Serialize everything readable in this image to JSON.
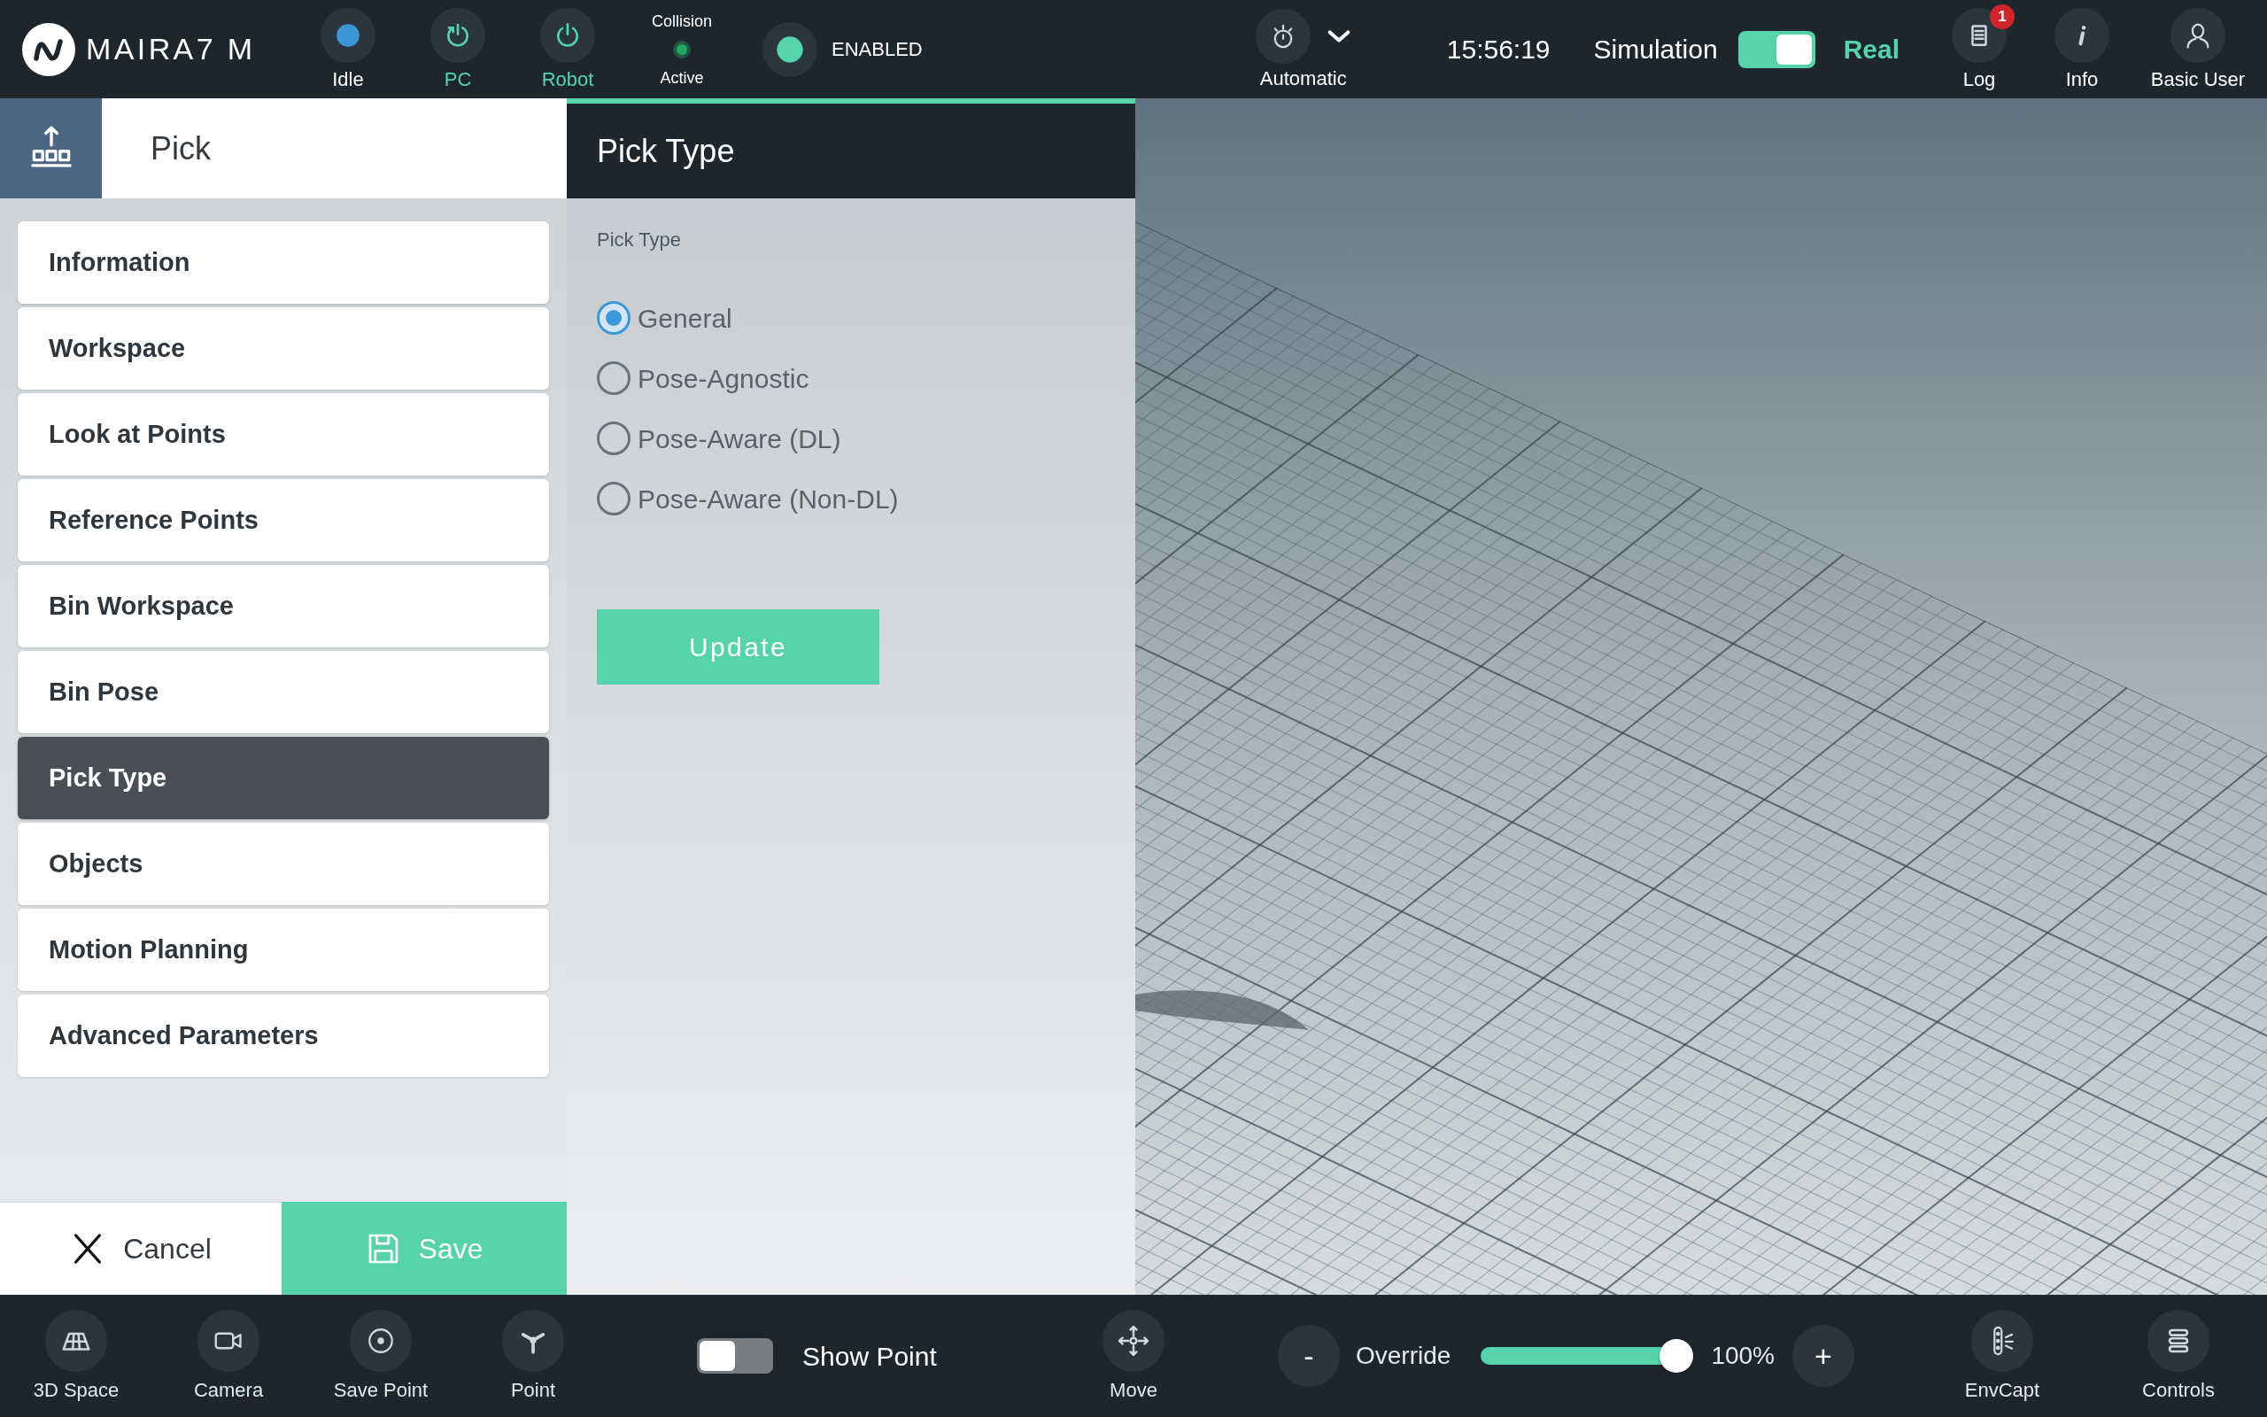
{
  "header": {
    "brand": "MAIRA7 M",
    "status": [
      {
        "kind": "state",
        "label": "Idle"
      },
      {
        "kind": "powercycle",
        "label": "PC",
        "active": true
      },
      {
        "kind": "power",
        "label": "Robot",
        "active": true
      }
    ],
    "collision": {
      "title": "Collision",
      "status": "Active",
      "active": true
    },
    "enable": {
      "label": "ENABLED",
      "on": true
    },
    "mode": {
      "label": "Automatic"
    },
    "time": "15:56:19",
    "mode_switch": {
      "left_label": "Simulation",
      "right_label": "Real",
      "on": true
    },
    "actions": [
      {
        "kind": "log",
        "label": "Log",
        "badge": "1"
      },
      {
        "kind": "info",
        "label": "Info"
      },
      {
        "kind": "user",
        "label": "Basic User"
      }
    ]
  },
  "sidebar": {
    "title": "Pick",
    "items": [
      {
        "label": "Information",
        "selected": false
      },
      {
        "label": "Workspace",
        "selected": false
      },
      {
        "label": "Look at Points",
        "selected": false
      },
      {
        "label": "Reference Points",
        "selected": false
      },
      {
        "label": "Bin Workspace",
        "selected": false
      },
      {
        "label": "Bin Pose",
        "selected": false
      },
      {
        "label": "Pick Type",
        "selected": true
      },
      {
        "label": "Objects",
        "selected": false
      },
      {
        "label": "Motion Planning",
        "selected": false
      },
      {
        "label": "Advanced Parameters",
        "selected": false
      }
    ],
    "cancel": "Cancel",
    "save": "Save"
  },
  "panel": {
    "title": "Pick Type",
    "field_label": "Pick Type",
    "options": [
      {
        "label": "General",
        "selected": true
      },
      {
        "label": "Pose-Agnostic",
        "selected": false
      },
      {
        "label": "Pose-Aware (DL)",
        "selected": false
      },
      {
        "label": "Pose-Aware (Non-DL)",
        "selected": false
      }
    ],
    "button": "Update"
  },
  "toolbar": {
    "tools": [
      {
        "kind": "space",
        "label": "3D Space"
      },
      {
        "kind": "camera",
        "label": "Camera"
      },
      {
        "kind": "savepoint",
        "label": "Save Point"
      },
      {
        "kind": "point",
        "label": "Point"
      }
    ],
    "show_point": {
      "label": "Show Point",
      "on": false
    },
    "move": {
      "label": "Move"
    },
    "override": {
      "decrease": "-",
      "label": "Override",
      "level": 1,
      "reading": "100%",
      "increase": "+"
    },
    "tools_right": [
      {
        "kind": "envcapt",
        "label": "EnvCapt"
      },
      {
        "kind": "controls",
        "label": "Controls"
      }
    ]
  }
}
